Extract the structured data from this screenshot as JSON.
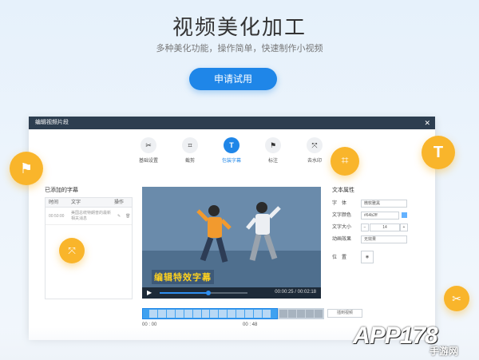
{
  "hero": {
    "title": "视频美化加工",
    "subtitle": "多种美化功能，操作简单，快速制作小视频",
    "apply_label": "申请试用"
  },
  "editor": {
    "window_title": "编辑视频片段",
    "close_icon": "close-icon",
    "tools": [
      {
        "label": "基础设置",
        "icon": "scissors-icon",
        "glyph": "✂",
        "active": false
      },
      {
        "label": "截剪",
        "icon": "crop-icon",
        "glyph": "⌗",
        "active": false
      },
      {
        "label": "包装字幕",
        "icon": "text-icon",
        "glyph": "T",
        "active": true
      },
      {
        "label": "标注",
        "icon": "bookmark-icon",
        "glyph": "⚑",
        "active": false
      },
      {
        "label": "去水印",
        "icon": "watermark-remove-icon",
        "glyph": "⤧",
        "active": false
      }
    ],
    "subtitles": {
      "title": "已添加的字幕",
      "columns": [
        "时间",
        "文字",
        "操作"
      ],
      "rows": [
        {
          "time": "00:50:00",
          "text": "美国总统特朗普的最新相关消息"
        }
      ]
    },
    "video": {
      "caption": "编辑特效字幕",
      "timecode": "00:00:25 / 00:02:18",
      "progress": 0.55
    },
    "text_props": {
      "title": "文本属性",
      "font_label": "字　体",
      "font_value": "微软雅黑",
      "color_label": "文字颜色",
      "color_value": "#64b2ff",
      "size_label": "文字大小",
      "size_value": "14",
      "size_minus": "−",
      "size_plus": "+",
      "effect_label": "动画效果",
      "effect_value": "无效果",
      "position_label": "位　置",
      "position_glyph": "◉"
    },
    "timeline": {
      "start": "00 : 00",
      "mid": "00 : 48",
      "button_label": "插到视频"
    }
  },
  "watermark": {
    "brand": "APP178",
    "sub": "手游网"
  },
  "colors": {
    "accent": "#1f86e8",
    "float_badge": "#f9b52b",
    "caption": "#ffd21f"
  }
}
